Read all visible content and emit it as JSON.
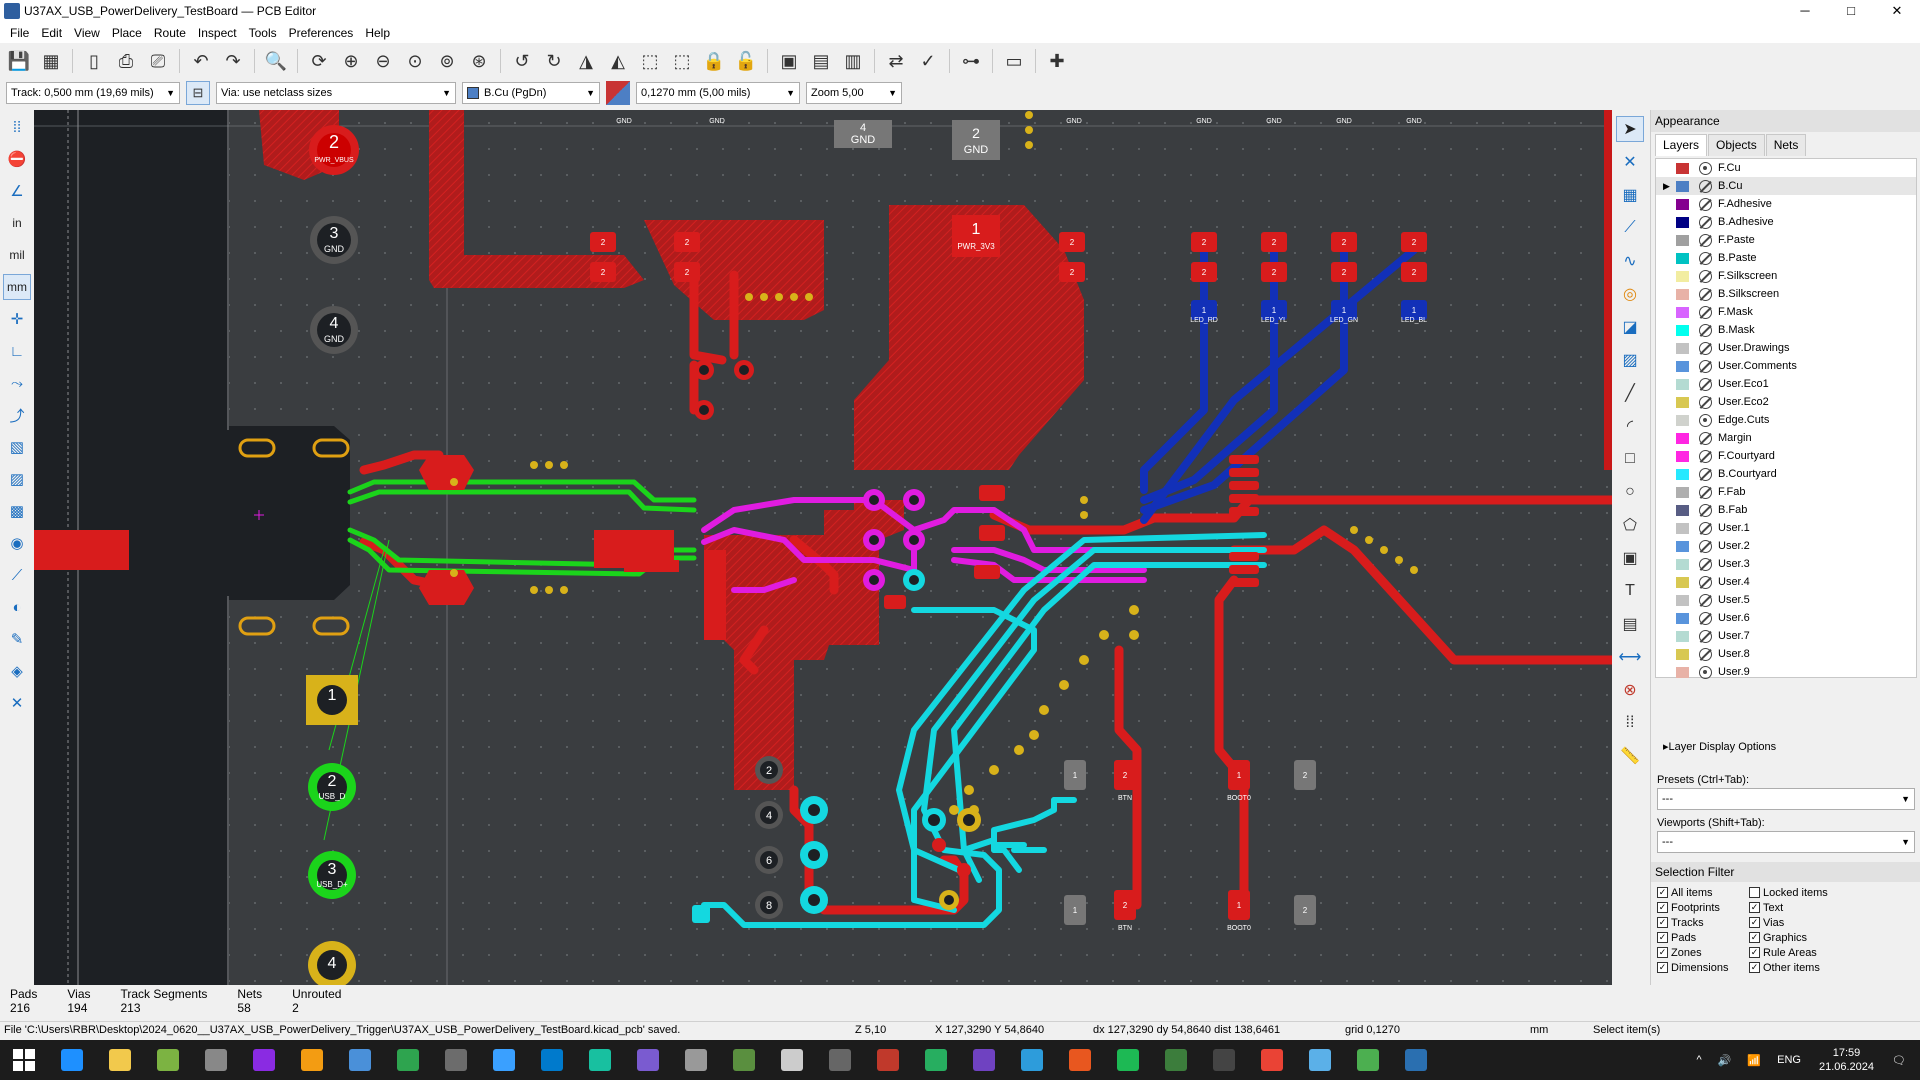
{
  "window": {
    "title": "U37AX_USB_PowerDelivery_TestBoard — PCB Editor",
    "controls": [
      "─",
      "□",
      "✕"
    ]
  },
  "menu": [
    "File",
    "Edit",
    "View",
    "Place",
    "Route",
    "Inspect",
    "Tools",
    "Preferences",
    "Help"
  ],
  "auxbar": {
    "track": "Track: 0,500 mm (19,69 mils)",
    "via": "Via: use netclass sizes",
    "layer": "B.Cu (PgDn)",
    "layer_color": "#4d7fc4",
    "grid": "0,1270 mm (5,00 mils)",
    "zoom": "Zoom 5,00"
  },
  "left_toolbar_text": [
    "in",
    "mil",
    "mm"
  ],
  "appearance": {
    "title": "Appearance",
    "tabs": [
      "Layers",
      "Objects",
      "Nets"
    ],
    "layers": [
      {
        "name": "F.Cu",
        "color": "#c83434",
        "visible": true
      },
      {
        "name": "B.Cu",
        "color": "#4d7fc4",
        "visible": false
      },
      {
        "name": "F.Adhesive",
        "color": "#84008f",
        "visible": false
      },
      {
        "name": "B.Adhesive",
        "color": "#000084",
        "visible": false
      },
      {
        "name": "F.Paste",
        "color": "#a0a0a0",
        "visible": false
      },
      {
        "name": "B.Paste",
        "color": "#00c2c2",
        "visible": false
      },
      {
        "name": "F.Silkscreen",
        "color": "#f2eda1",
        "visible": false
      },
      {
        "name": "B.Silkscreen",
        "color": "#e8b2a7",
        "visible": false
      },
      {
        "name": "F.Mask",
        "color": "#d864ff",
        "visible": false
      },
      {
        "name": "B.Mask",
        "color": "#02ffee",
        "visible": false
      },
      {
        "name": "User.Drawings",
        "color": "#c2c2c2",
        "visible": false
      },
      {
        "name": "User.Comments",
        "color": "#5994dc",
        "visible": false
      },
      {
        "name": "User.Eco1",
        "color": "#b4dbd2",
        "visible": false
      },
      {
        "name": "User.Eco2",
        "color": "#d8c852",
        "visible": false
      },
      {
        "name": "Edge.Cuts",
        "color": "#d0d2cd",
        "visible": true
      },
      {
        "name": "Margin",
        "color": "#ff26e2",
        "visible": false
      },
      {
        "name": "F.Courtyard",
        "color": "#ff26e2",
        "visible": false
      },
      {
        "name": "B.Courtyard",
        "color": "#26e9ff",
        "visible": false
      },
      {
        "name": "F.Fab",
        "color": "#afafaf",
        "visible": false
      },
      {
        "name": "B.Fab",
        "color": "#585d84",
        "visible": false
      },
      {
        "name": "User.1",
        "color": "#c2c2c2",
        "visible": false
      },
      {
        "name": "User.2",
        "color": "#5994dc",
        "visible": false
      },
      {
        "name": "User.3",
        "color": "#b4dbd2",
        "visible": false
      },
      {
        "name": "User.4",
        "color": "#d8c852",
        "visible": false
      },
      {
        "name": "User.5",
        "color": "#c2c2c2",
        "visible": false
      },
      {
        "name": "User.6",
        "color": "#5994dc",
        "visible": false
      },
      {
        "name": "User.7",
        "color": "#b4dbd2",
        "visible": false
      },
      {
        "name": "User.8",
        "color": "#d8c852",
        "visible": false
      },
      {
        "name": "User.9",
        "color": "#e8b2a7",
        "visible": true
      }
    ],
    "layer_display_options": "Layer Display Options",
    "presets_label": "Presets (Ctrl+Tab):",
    "presets_value": "---",
    "viewports_label": "Viewports (Shift+Tab):",
    "viewports_value": "---"
  },
  "selection_filter": {
    "title": "Selection Filter",
    "items": [
      {
        "label": "All items",
        "checked": true
      },
      {
        "label": "Locked items",
        "checked": false
      },
      {
        "label": "Footprints",
        "checked": true
      },
      {
        "label": "Text",
        "checked": true
      },
      {
        "label": "Tracks",
        "checked": true
      },
      {
        "label": "Vias",
        "checked": true
      },
      {
        "label": "Pads",
        "checked": true
      },
      {
        "label": "Graphics",
        "checked": true
      },
      {
        "label": "Zones",
        "checked": true
      },
      {
        "label": "Rule Areas",
        "checked": true
      },
      {
        "label": "Dimensions",
        "checked": true
      },
      {
        "label": "Other items",
        "checked": true
      }
    ]
  },
  "stats": [
    {
      "label": "Pads",
      "value": "216"
    },
    {
      "label": "Vias",
      "value": "194"
    },
    {
      "label": "Track Segments",
      "value": "213"
    },
    {
      "label": "Nets",
      "value": "58"
    },
    {
      "label": "Unrouted",
      "value": "2"
    }
  ],
  "statusbar": {
    "message": "File 'C:\\Users\\RBR\\Desktop\\2024_0620__U37AX_USB_PowerDelivery_Trigger\\U37AX_USB_PowerDelivery_TestBoard.kicad_pcb' saved.",
    "zoom": "Z 5,10",
    "xy": "X 127,3290  Y 54,8640",
    "delta": "dx 127,3290  dy 54,8640  dist 138,6461",
    "grid": "grid 0,1270",
    "units": "mm",
    "mode": "Select item(s)"
  },
  "pcb_labels": {
    "pwr_vbus_num": "2",
    "pwr_vbus": "PWR_VBUS",
    "gnd3_num": "3",
    "gnd3": "GND",
    "gnd4_num": "4",
    "gnd4": "GND",
    "pwr3v3_num": "1",
    "pwr3v3": "PWR_3V3",
    "gnd_top_num": "2",
    "gnd_top": "GND",
    "gnd4_top_num": "4",
    "gnd4_top": "GND",
    "usb_d_num": "2",
    "usb_d": "USB_D",
    "usb_dp_num": "3",
    "usb_dp": "USB_D+",
    "gnd_small": "GND",
    "led_labels": [
      "LED_RD",
      "LED_YL",
      "LED_GN",
      "LED_BL"
    ],
    "btn": "BTN",
    "boot0": "BOOT0",
    "pin_labels": [
      "2",
      "4",
      "6",
      "8"
    ]
  },
  "taskbar": {
    "lang": "ENG",
    "time": "17:59",
    "date": "21.06.2024",
    "apps": [
      "#1e90ff",
      "#f2c94c",
      "#7cb342",
      "#888",
      "#8a2be2",
      "#f39c12",
      "#4a90d9",
      "#2ea44f",
      "#6c6c6c",
      "#3aa0ff",
      "#007acc",
      "#18c0a0",
      "#7a5bd0",
      "#999",
      "#5a8f3f",
      "#ccc",
      "#666",
      "#c0392b",
      "#27ae60",
      "#6f42c1",
      "#2d9cdb",
      "#e8571f",
      "#1db954",
      "#3c7d3c",
      "#444",
      "#ea4335",
      "#5bb0e8",
      "#4caf50",
      "#2a6fb0"
    ]
  }
}
